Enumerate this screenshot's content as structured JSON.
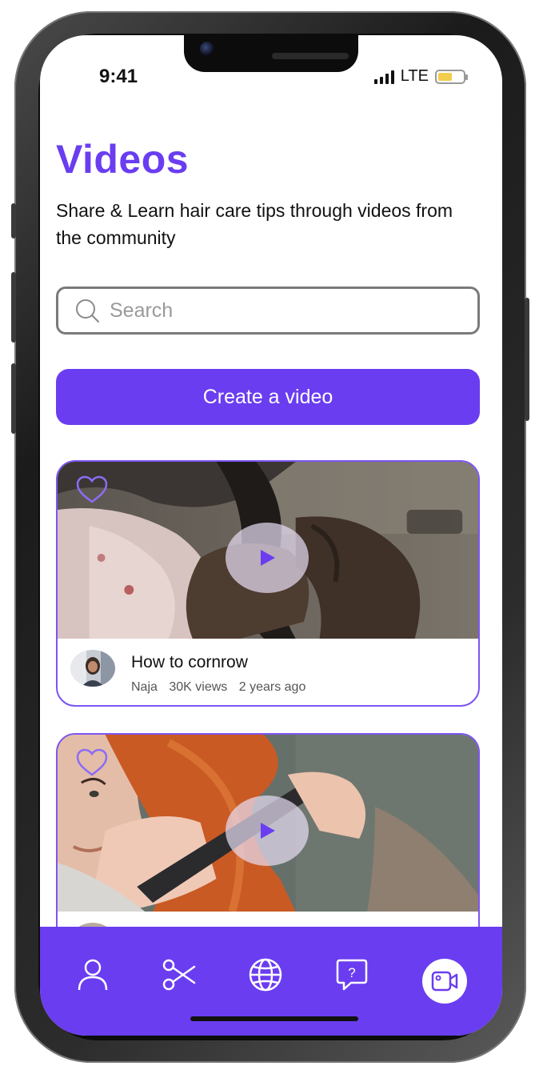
{
  "status": {
    "time": "9:41",
    "network": "LTE",
    "battery_level": 0.55
  },
  "page": {
    "title": "Videos",
    "subtitle": "Share & Learn hair care tips through videos from the community"
  },
  "search": {
    "placeholder": "Search"
  },
  "create_button": {
    "label": "Create a video"
  },
  "videos": [
    {
      "title": "How to cornrow",
      "author": "Naja",
      "views": "30K views",
      "age": "2 years ago",
      "liked": false
    }
  ],
  "tabbar": {
    "items": [
      {
        "icon": "person-icon",
        "active": false
      },
      {
        "icon": "scissors-icon",
        "active": false
      },
      {
        "icon": "globe-icon",
        "active": false
      },
      {
        "icon": "question-chat-icon",
        "active": false
      },
      {
        "icon": "video-camera-icon",
        "active": true
      }
    ]
  },
  "colors": {
    "accent": "#6a3df0",
    "border": "#7a7a7a",
    "battery": "#f2cd4e"
  }
}
